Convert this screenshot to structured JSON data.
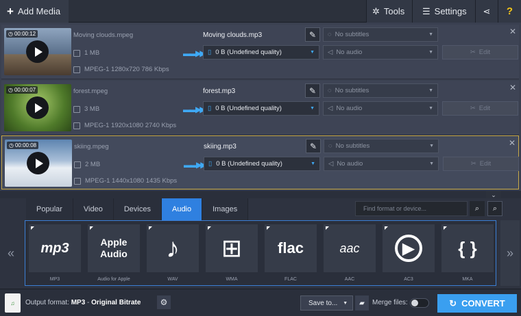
{
  "toolbar": {
    "add_media": "Add Media",
    "tools": "Tools",
    "settings": "Settings",
    "help": "?"
  },
  "files": [
    {
      "duration": "00:00:12",
      "source_name": "Moving clouds.mpeg",
      "source_size": "1 MB",
      "source_meta": "MPEG-1 1280x720 786 Kbps",
      "output_name": "Moving clouds.mp3",
      "output_size": "0 B (Undefined quality)",
      "subtitles": "No subtitles",
      "audio": "No audio",
      "edit": "Edit",
      "thumb_color": "#6a7d96"
    },
    {
      "duration": "00:00:07",
      "source_name": "forest.mpeg",
      "source_size": "3 MB",
      "source_meta": "MPEG-1 1920x1080 2740 Kbps",
      "output_name": "forest.mp3",
      "output_size": "0 B (Undefined quality)",
      "subtitles": "No subtitles",
      "audio": "No audio",
      "edit": "Edit",
      "thumb_color": "#4f7a2a"
    },
    {
      "duration": "00:00:08",
      "source_name": "skiing.mpeg",
      "source_size": "2 MB",
      "source_meta": "MPEG-1 1440x1080 1435 Kbps",
      "output_name": "skiing.mp3",
      "output_size": "0 B (Undefined quality)",
      "subtitles": "No subtitles",
      "audio": "No audio",
      "edit": "Edit",
      "thumb_color": "#7c97b6"
    }
  ],
  "tabs": [
    "Popular",
    "Video",
    "Devices",
    "Audio",
    "Images"
  ],
  "active_tab": "Audio",
  "search": {
    "placeholder": "Find format or device..."
  },
  "formats": [
    {
      "label": "MP3",
      "icon_text": "mp3"
    },
    {
      "label": "Audio for Apple",
      "icon_text": "Apple Audio"
    },
    {
      "label": "WAV",
      "icon_text": "♪"
    },
    {
      "label": "WMA",
      "icon_text": "⊞"
    },
    {
      "label": "FLAC",
      "icon_text": "flac"
    },
    {
      "label": "AAC",
      "icon_text": "aac"
    },
    {
      "label": "AC3",
      "icon_text": "▶"
    },
    {
      "label": "MKA",
      "icon_text": "{ }"
    }
  ],
  "bottom": {
    "output_label": "Output format:",
    "output_format": "MP3",
    "output_sep": " - ",
    "output_quality": "Original Bitrate",
    "save_to": "Save to...",
    "merge_files": "Merge files:",
    "convert": "CONVERT"
  },
  "colors": {
    "accent": "#3a9ff0",
    "selected_border": "#c8a94a"
  }
}
